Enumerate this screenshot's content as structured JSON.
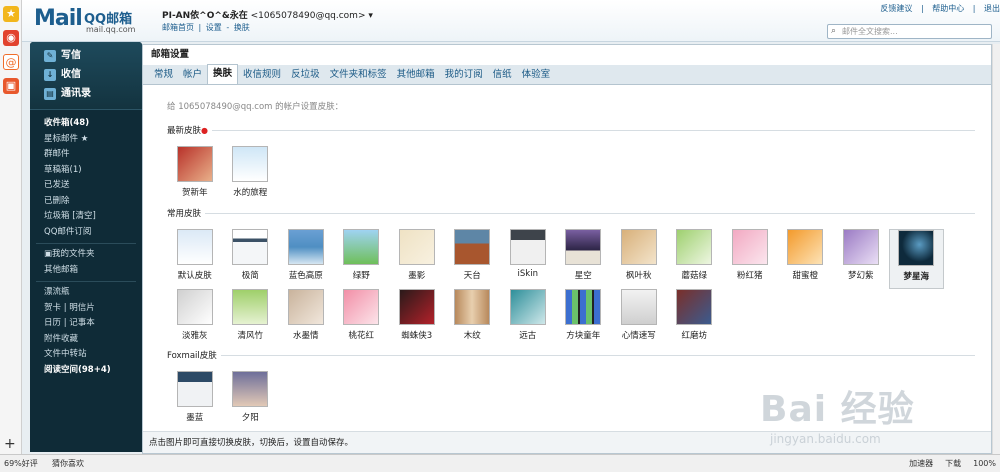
{
  "header": {
    "logo_mark": "Mail",
    "logo_name": "QQ邮箱",
    "logo_domain": "mail.qq.com",
    "account": "PI-AN依^O^&永在",
    "email": "<1065078490@qq.com>",
    "dropdown": "▾",
    "links": [
      "邮箱首页",
      "|",
      "设置",
      "-",
      "换肤"
    ],
    "top_links": [
      "反馈建议",
      "|",
      "帮助中心",
      "|",
      "退出"
    ],
    "search_placeholder": "邮件全文搜索..."
  },
  "sidebar": {
    "write": "写信",
    "inbox_btn": "收信",
    "contacts": "通讯录",
    "folders": [
      "收件箱(48)",
      "星标邮件 ★",
      "群邮件",
      "草稿箱(1)",
      "已发送",
      "已删除",
      "垃圾箱  [清空]",
      "QQ邮件订阅"
    ],
    "my_folders": [
      "▣我的文件夹",
      "其他邮箱"
    ],
    "apps": [
      "漂流瓶",
      "贺卡 | 明信片",
      "日历 | 记事本",
      "附件收藏",
      "文件中转站",
      "阅读空间(98+4)"
    ]
  },
  "main": {
    "title": "邮箱设置",
    "tabs": [
      "常规",
      "帐户",
      "换肤",
      "收信规则",
      "反垃圾",
      "文件夹和标签",
      "其他邮箱",
      "我的订阅",
      "信纸",
      "体验室"
    ],
    "active_tab": "换肤",
    "desc": "给 1065078490@qq.com 的帐户设置皮肤：",
    "new_heading": "最新皮肤",
    "new_dot": "●",
    "new_skins": [
      "贺新年",
      "水的旅程"
    ],
    "common_heading": "常用皮肤",
    "common_skins": [
      "默认皮肤",
      "极简",
      "蓝色高原",
      "绿野",
      "墨影",
      "天台",
      "iSkin",
      "星空",
      "枫叶秋",
      "蘑菇绿",
      "粉红猪",
      "甜蜜橙",
      "梦幻紫",
      "梦星海",
      "淡雅灰",
      "清风竹",
      "水墨情",
      "桃花红",
      "蜘蛛侠3",
      "木纹",
      "远古",
      "方块童年",
      "心情速写",
      "红磨坊"
    ],
    "selected_skin": "梦星海",
    "foxmail_heading": "Foxmail皮肤",
    "foxmail_skins": [
      "墨蓝",
      "夕阳"
    ],
    "footer": "点击图片即可直接切换皮肤，切换后，设置自动保存。"
  },
  "watermark": {
    "big": "Bai 经验",
    "url": "jingyan.baidu.com"
  },
  "statusbar": {
    "left": "69%好评",
    "left2": "猜你喜欢",
    "right": [
      "加速器",
      "下载",
      "100%"
    ]
  },
  "colors": {
    "sidebar_bg": "#0f2b37",
    "link": "#1d5e8e",
    "tab_bar": "#dfe8ee"
  },
  "icons": [
    "star-icon",
    "weibo-icon",
    "email-icon",
    "gift-icon",
    "plus-icon",
    "search-icon"
  ]
}
